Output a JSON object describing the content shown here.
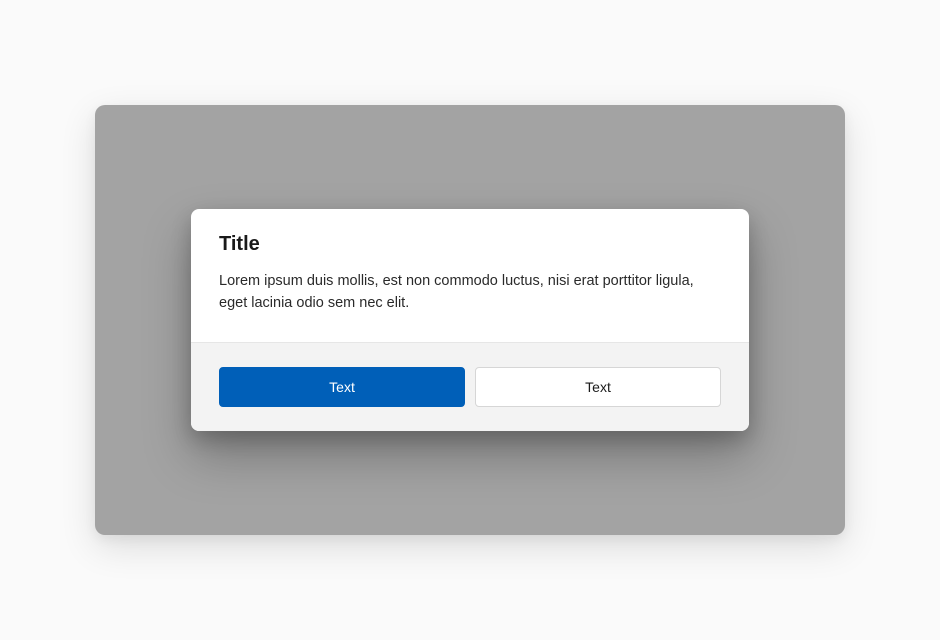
{
  "dialog": {
    "title": "Title",
    "body": "Lorem ipsum duis mollis, est non commodo luctus, nisi erat porttitor ligula, eget lacinia odio sem nec elit.",
    "primary_button_label": "Text",
    "secondary_button_label": "Text"
  }
}
